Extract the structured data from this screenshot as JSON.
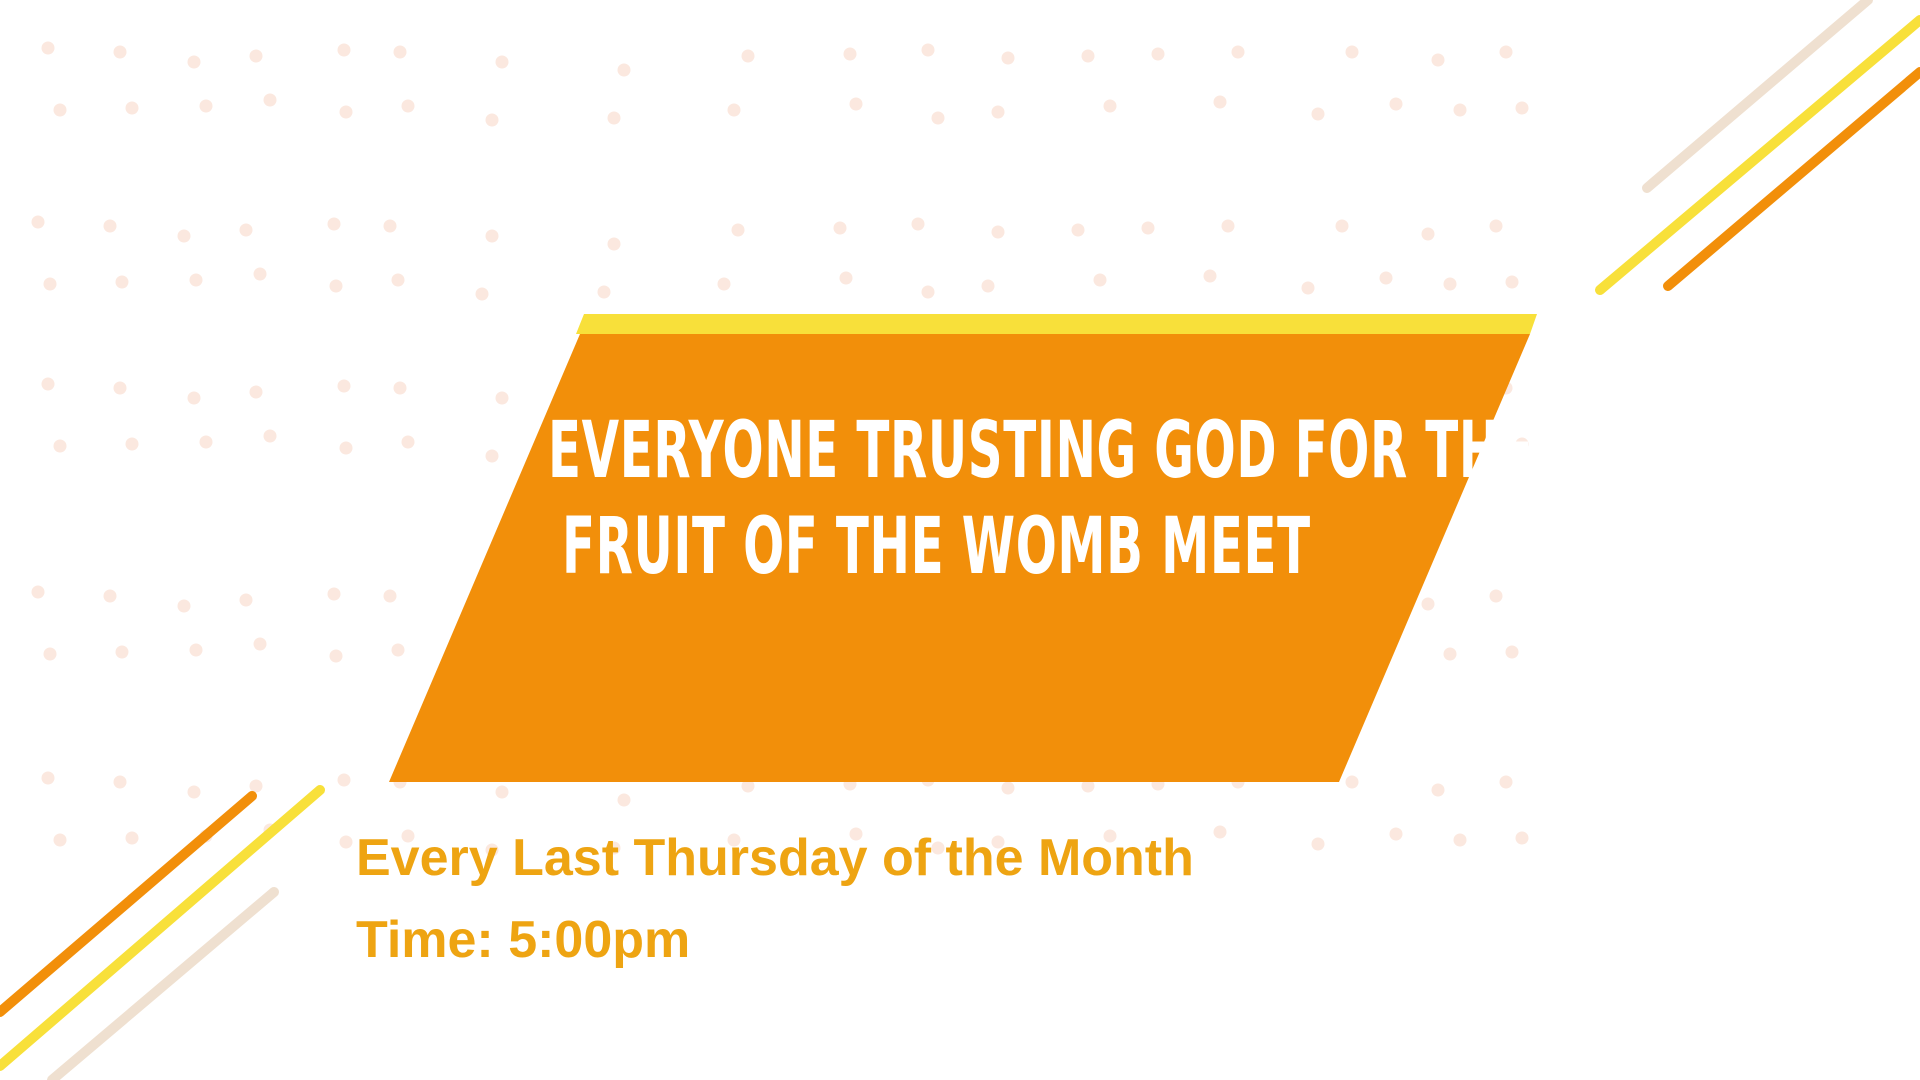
{
  "colors": {
    "background": "#ffffff",
    "banner_fill": "#f28f0a",
    "banner_top_stripe": "#f8e03a",
    "headline_text": "#ffffff",
    "info_text": "#eea412",
    "dots": "#fbe8df",
    "stripe_orange": "#f28f0a",
    "stripe_yellow": "#f8e03a",
    "stripe_beige": "#efe0d0"
  },
  "banner": {
    "headline_line_1": "EVERYONE TRUSTING GOD FOR THE",
    "headline_line_2": "FRUIT OF THE WOMB MEET"
  },
  "details": {
    "schedule": "Every Last Thursday of the Month",
    "time": "Time: 5:00pm"
  }
}
